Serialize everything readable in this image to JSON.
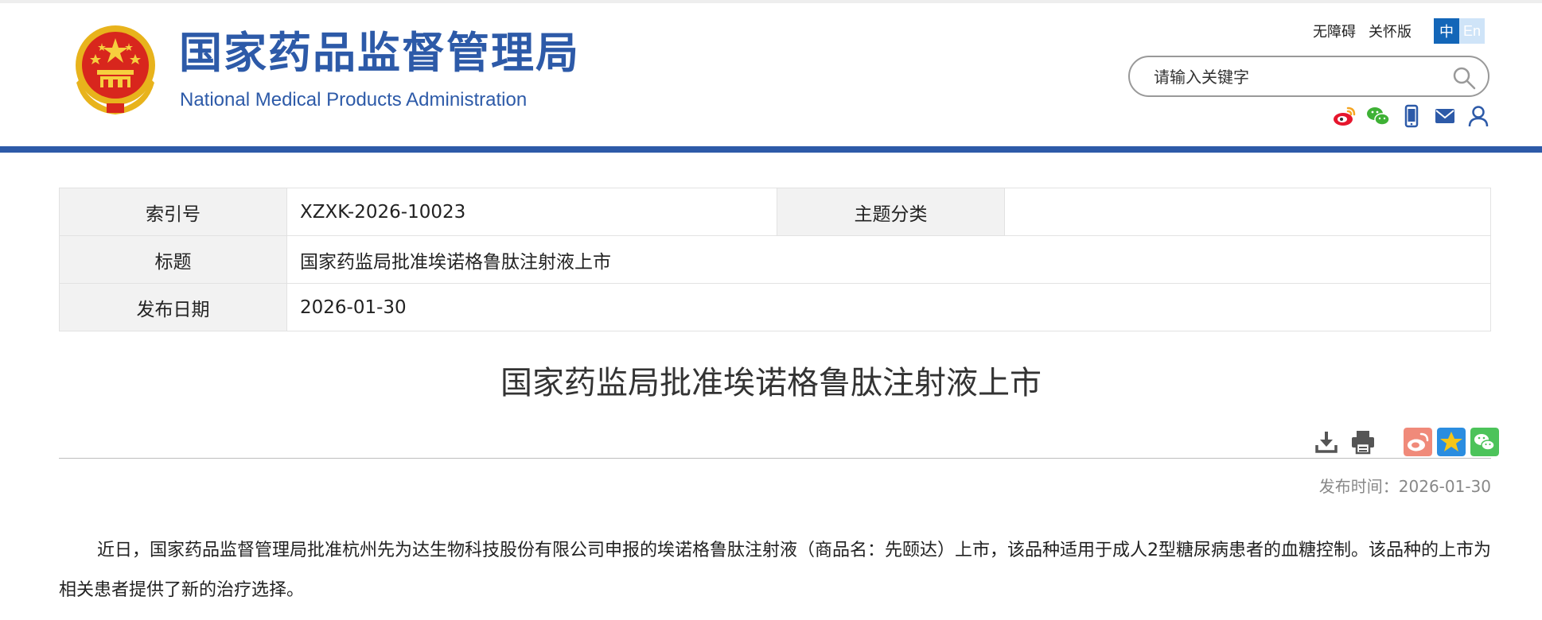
{
  "header": {
    "title_cn": "国家药品监督管理局",
    "title_en": "National Medical Products Administration",
    "util_links": [
      "无障碍",
      "关怀版"
    ],
    "lang": {
      "zh": "中",
      "en": "En"
    },
    "search": {
      "placeholder": "请输入关键字"
    },
    "social_icons": [
      "weibo-icon",
      "wechat-icon",
      "mobile-icon",
      "mail-icon",
      "user-icon"
    ]
  },
  "colors": {
    "brand_blue": "#2d5aa8",
    "lang_active": "#1366b8",
    "weibo_share": "#f08a7a",
    "favorite_share": "#2b8de0",
    "wechat_share": "#4cc35a"
  },
  "meta": {
    "index_label": "索引号",
    "index_value": "XZXK-2026-10023",
    "topic_label": "主题分类",
    "topic_value": "",
    "title_label": "标题",
    "title_value": "国家药监局批准埃诺格鲁肽注射液上市",
    "date_label": "发布日期",
    "date_value": "2026-01-30"
  },
  "article": {
    "title": "国家药监局批准埃诺格鲁肽注射液上市",
    "publish_label": "发布时间：",
    "publish_value": "2026-01-30",
    "body": "近日，国家药品监督管理局批准杭州先为达生物科技股份有限公司申报的埃诺格鲁肽注射液（商品名：先颐达）上市，该品种适用于成人2型糖尿病患者的血糖控制。该品种的上市为相关患者提供了新的治疗选择。",
    "tools": [
      "download-icon",
      "print-icon"
    ],
    "share": [
      "weibo-share-icon",
      "favorite-share-icon",
      "wechat-share-icon"
    ]
  }
}
